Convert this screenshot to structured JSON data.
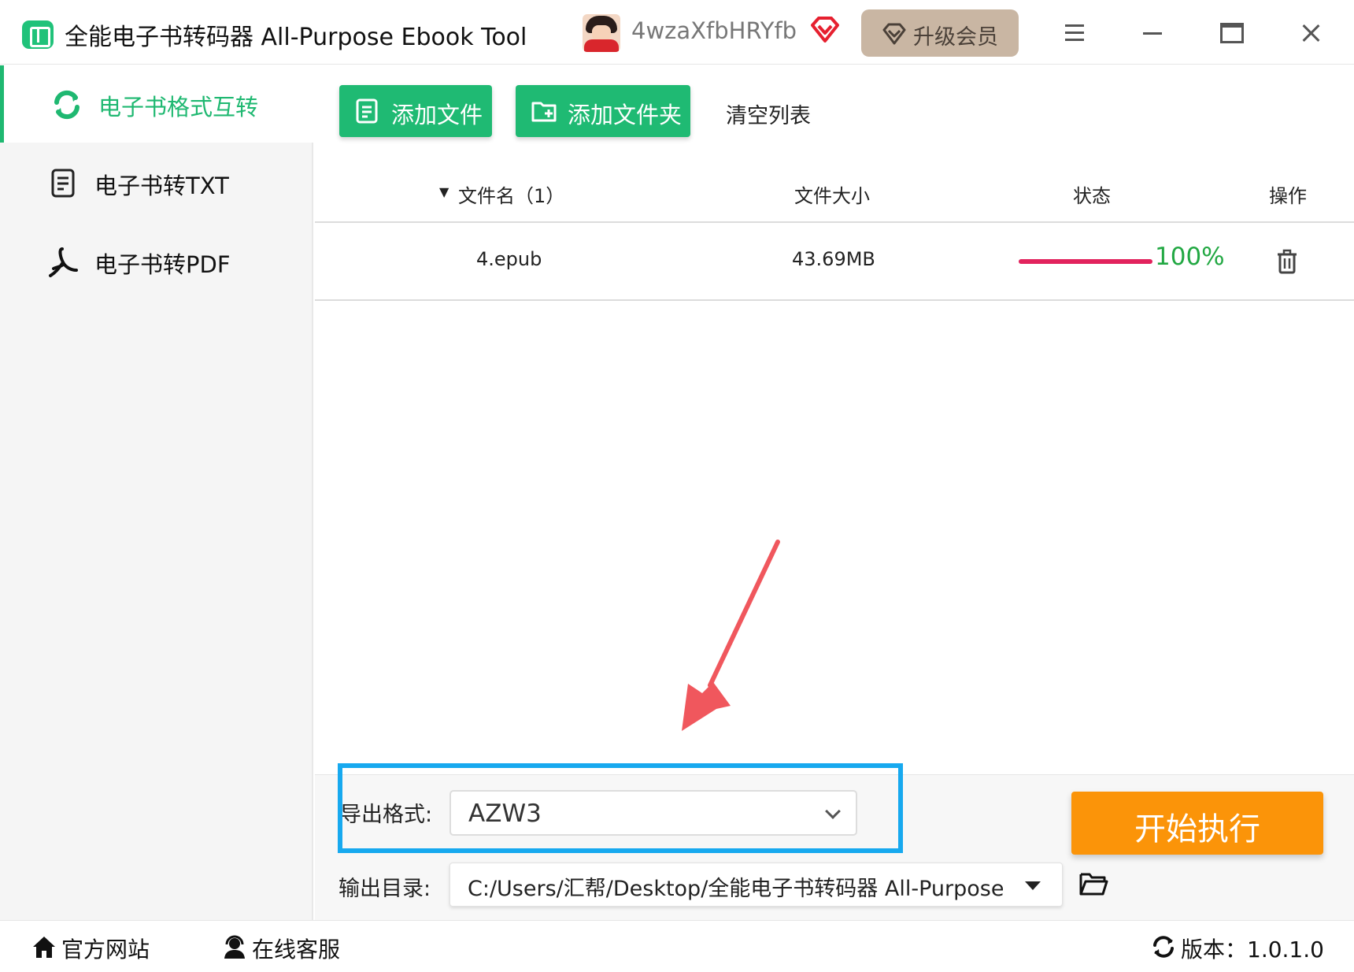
{
  "app": {
    "title": "全能电子书转码器 All-Purpose Ebook Tool"
  },
  "user": {
    "name": "4wzaXfbHRYfb",
    "upgrade_label": "升级会员"
  },
  "sidebar": {
    "items": [
      {
        "label": "电子书格式互转",
        "icon": "refresh-icon",
        "active": true
      },
      {
        "label": "电子书转TXT",
        "icon": "document-icon",
        "active": false
      },
      {
        "label": "电子书转PDF",
        "icon": "acrobat-icon",
        "active": false
      }
    ]
  },
  "toolbar": {
    "add_file": "添加文件",
    "add_folder": "添加文件夹",
    "clear_list": "清空列表"
  },
  "table": {
    "headers": {
      "name": "文件名（1）",
      "size": "文件大小",
      "status": "状态",
      "action": "操作"
    },
    "rows": [
      {
        "name": "4.epub",
        "size": "43.69MB",
        "progress": "100%"
      }
    ]
  },
  "bottom": {
    "format_label": "导出格式:",
    "format_value": "AZW3",
    "dir_label": "输出目录:",
    "dir_value": "C:/Users/汇帮/Desktop/全能电子书转码器 All-Purpose Ebook Tool",
    "start_label": "开始执行"
  },
  "status_bar": {
    "website": "官方网站",
    "support": "在线客服",
    "version": "版本：1.0.1.0"
  },
  "colors": {
    "accent": "#1fb871",
    "progress": "#e2235d",
    "percent": "#22a843",
    "start": "#fb9409",
    "highlight": "#17a9ef",
    "arrow": "#f0575d"
  }
}
